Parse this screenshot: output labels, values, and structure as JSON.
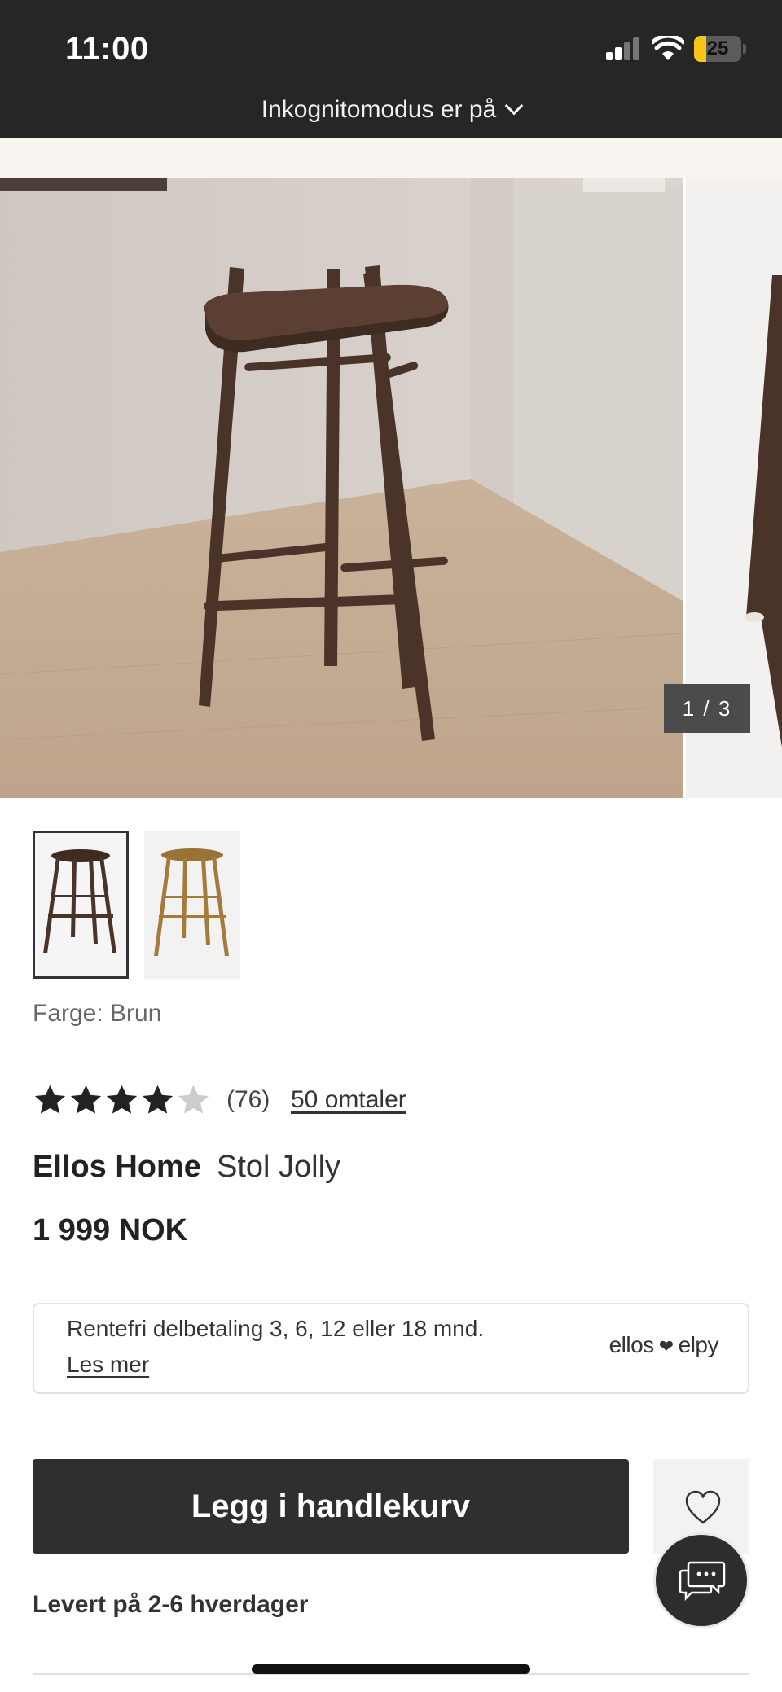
{
  "status_bar": {
    "time": "11:00",
    "battery": "25",
    "battery_level": 0.25,
    "incognito_text": "Inkognitomodus er på"
  },
  "gallery": {
    "counter": "1 / 3",
    "current_index": 1,
    "total": 3
  },
  "variants": {
    "color_label": "Farge: Brun"
  },
  "rating": {
    "stars": 4,
    "max_stars": 5,
    "count": "(76)",
    "reviews_link": "50 omtaler"
  },
  "product": {
    "brand": "Ellos Home",
    "name": "Stol Jolly",
    "price": "1 999 NOK"
  },
  "financing": {
    "text": "Rentefri delbetaling 3, 6, 12 eller 18 mnd.",
    "link": "Les mer",
    "logo_left": "ellos",
    "logo_right": "elpy"
  },
  "actions": {
    "add_to_cart": "Legg i handlekurv",
    "wishlist_icon": "heart-icon",
    "chat_icon": "chat-icon"
  },
  "delivery": {
    "text": "Levert på 2-6 hverdager"
  },
  "colors": {
    "dark": "#2f2f2f",
    "status_bar": "#262626",
    "battery": "#f5c518",
    "star_filled": "#222222",
    "star_empty": "#cccccc"
  }
}
